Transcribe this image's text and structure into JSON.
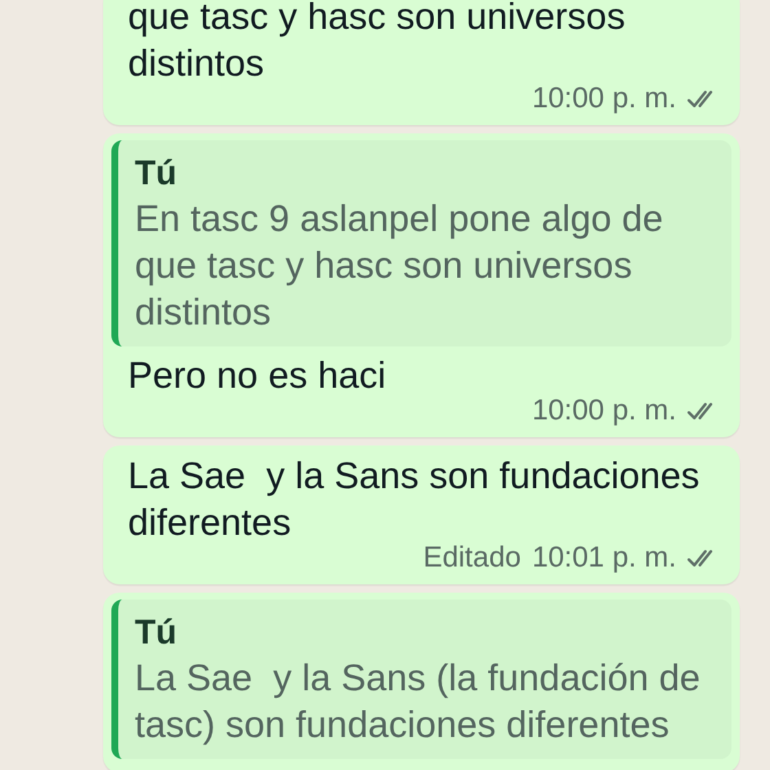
{
  "messages": [
    {
      "text": "que tasc y hasc son universos distintos",
      "time": "10:00 p. m.",
      "read": false
    },
    {
      "quote": {
        "author": "Tú",
        "text": "En tasc 9 aslanpel pone algo de que tasc y hasc son universos distintos"
      },
      "text": "Pero no es haci",
      "time": "10:00 p. m.",
      "read": false
    },
    {
      "text": "La Sae  y la Sans son fundaciones diferentes",
      "edited": "Editado",
      "time": "10:01 p. m.",
      "read": false
    },
    {
      "quote": {
        "author": "Tú",
        "text": "La Sae  y la Sans (la fundación de tasc) son fundaciones diferentes"
      }
    }
  ]
}
